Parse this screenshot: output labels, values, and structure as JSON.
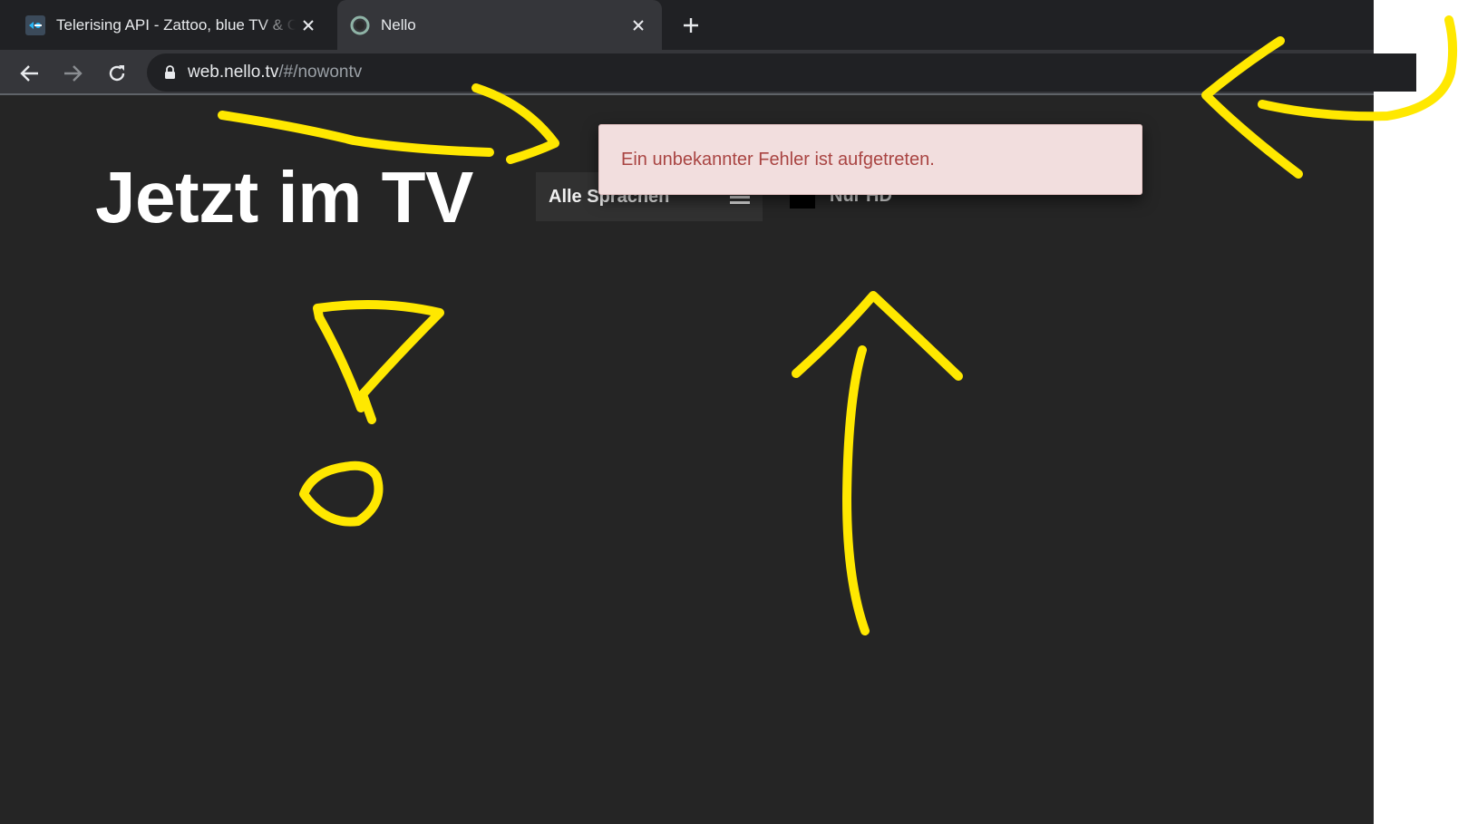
{
  "tabs": [
    {
      "title": "Telerising API - Zattoo, blue TV & Co.",
      "active": false
    },
    {
      "title": "Nello",
      "active": true
    }
  ],
  "toolbar": {
    "url_host": "web.nello.tv",
    "url_path": "/#/nowontv"
  },
  "page": {
    "title": "Jetzt im TV",
    "language_select": "Alle Sprachen",
    "hd_toggle_label": "Nur HD",
    "hd_checked": false
  },
  "error": {
    "message": "Ein unbekannter Fehler ist aufgetreten."
  },
  "colors": {
    "page_background": "#252525",
    "error_background": "#f2dede",
    "error_text": "#a94442",
    "annotation": "#ffe800"
  }
}
